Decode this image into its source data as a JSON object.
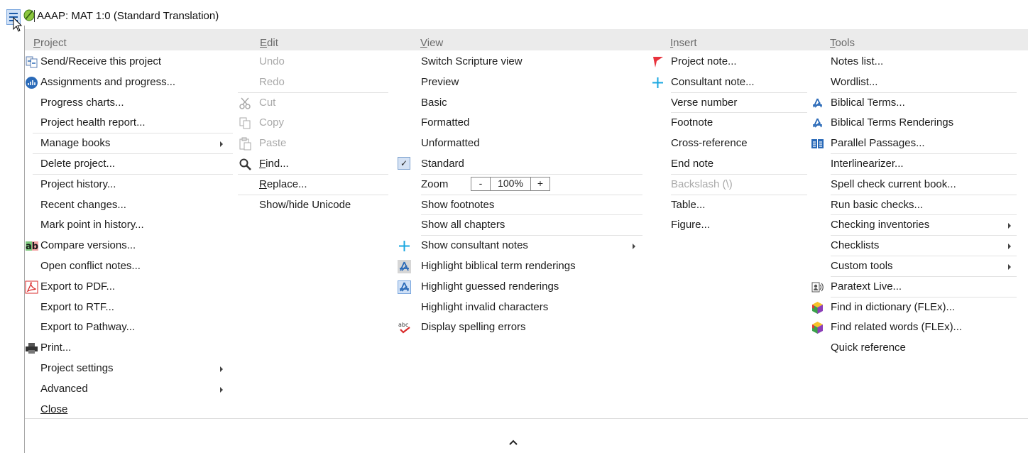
{
  "window": {
    "title": "AAAP: MAT 1:0 (Standard Translation)"
  },
  "menus": {
    "project": {
      "header_pre": "",
      "header_acc": "P",
      "header_post": "roject",
      "items": [
        "Send/Receive this project",
        "Assignments and progress...",
        "Progress charts...",
        "Project health report...",
        "Manage books",
        "Delete project...",
        "Project history...",
        "Recent changes...",
        "Mark point in history...",
        "Compare versions...",
        "Open conflict notes...",
        "Export to PDF...",
        "Export to RTF...",
        "Export to Pathway...",
        "Print...",
        "Project settings",
        "Advanced",
        "Close"
      ]
    },
    "edit": {
      "header_pre": "",
      "header_acc": "E",
      "header_post": "dit",
      "items": [
        "Undo",
        "Redo",
        "Cut",
        "Copy",
        "Paste"
      ],
      "find": {
        "acc": "F",
        "rest": "ind..."
      },
      "replace": {
        "acc": "R",
        "rest": "eplace..."
      },
      "unicode": "Show/hide Unicode"
    },
    "view": {
      "header_pre": "",
      "header_acc": "V",
      "header_post": "iew",
      "items": [
        "Switch Scripture view",
        "Preview",
        "Basic",
        "Formatted",
        "Unformatted",
        "Standard",
        "Zoom",
        "Show footnotes",
        "Show all chapters",
        "Show consultant notes",
        "Highlight biblical term renderings",
        "Highlight guessed renderings",
        "Highlight invalid characters",
        "Display spelling errors"
      ],
      "zoom": {
        "minus": "-",
        "value": "100%",
        "plus": "+"
      },
      "check_mark": "✓"
    },
    "insert": {
      "header_pre": "",
      "header_acc": "I",
      "header_post": "nsert",
      "items": [
        "Project note...",
        "Consultant note...",
        "Verse number",
        "Footnote",
        "Cross-reference",
        "End note",
        "Backslash (\\)",
        "Table...",
        "Figure..."
      ]
    },
    "tools": {
      "header_pre": "",
      "header_acc": "T",
      "header_post": "ools",
      "items": [
        "Notes list...",
        "Wordlist...",
        "Biblical Terms...",
        "Biblical Terms Renderings",
        "Parallel Passages...",
        "Interlinearizer...",
        "Spell check current book...",
        "Run basic checks...",
        "Checking inventories",
        "Checklists",
        "Custom tools",
        "Paratext Live...",
        "Find in dictionary (FLEx)...",
        "Find related words (FLEx)...",
        "Quick reference"
      ]
    }
  },
  "icons": {
    "menu": "hamburger-menu-icon",
    "app": "paratext-app-icon",
    "send_receive": "send-receive-icon",
    "assignments": "progress-chart-icon",
    "cut": "scissors-icon",
    "copy": "copy-icon",
    "paste": "paste-icon",
    "find": "magnifier-icon",
    "compare": "compare-text-icon",
    "pdf": "pdf-icon",
    "print": "printer-icon",
    "project_note": "red-flag-icon",
    "consultant_note": "plus-icon",
    "biblical_terms": "biblical-terms-icon",
    "parallel": "parallel-passages-icon",
    "live": "paratext-live-icon",
    "flex": "flex-cube-icon",
    "spelling": "spelling-errors-icon",
    "collapse": "chevron-up-icon"
  },
  "colors": {
    "accent_blue": "#2a6ab8",
    "flag_red": "#e8323c",
    "plus_cyan": "#1aa7e0",
    "header_bg": "#ebebeb"
  }
}
